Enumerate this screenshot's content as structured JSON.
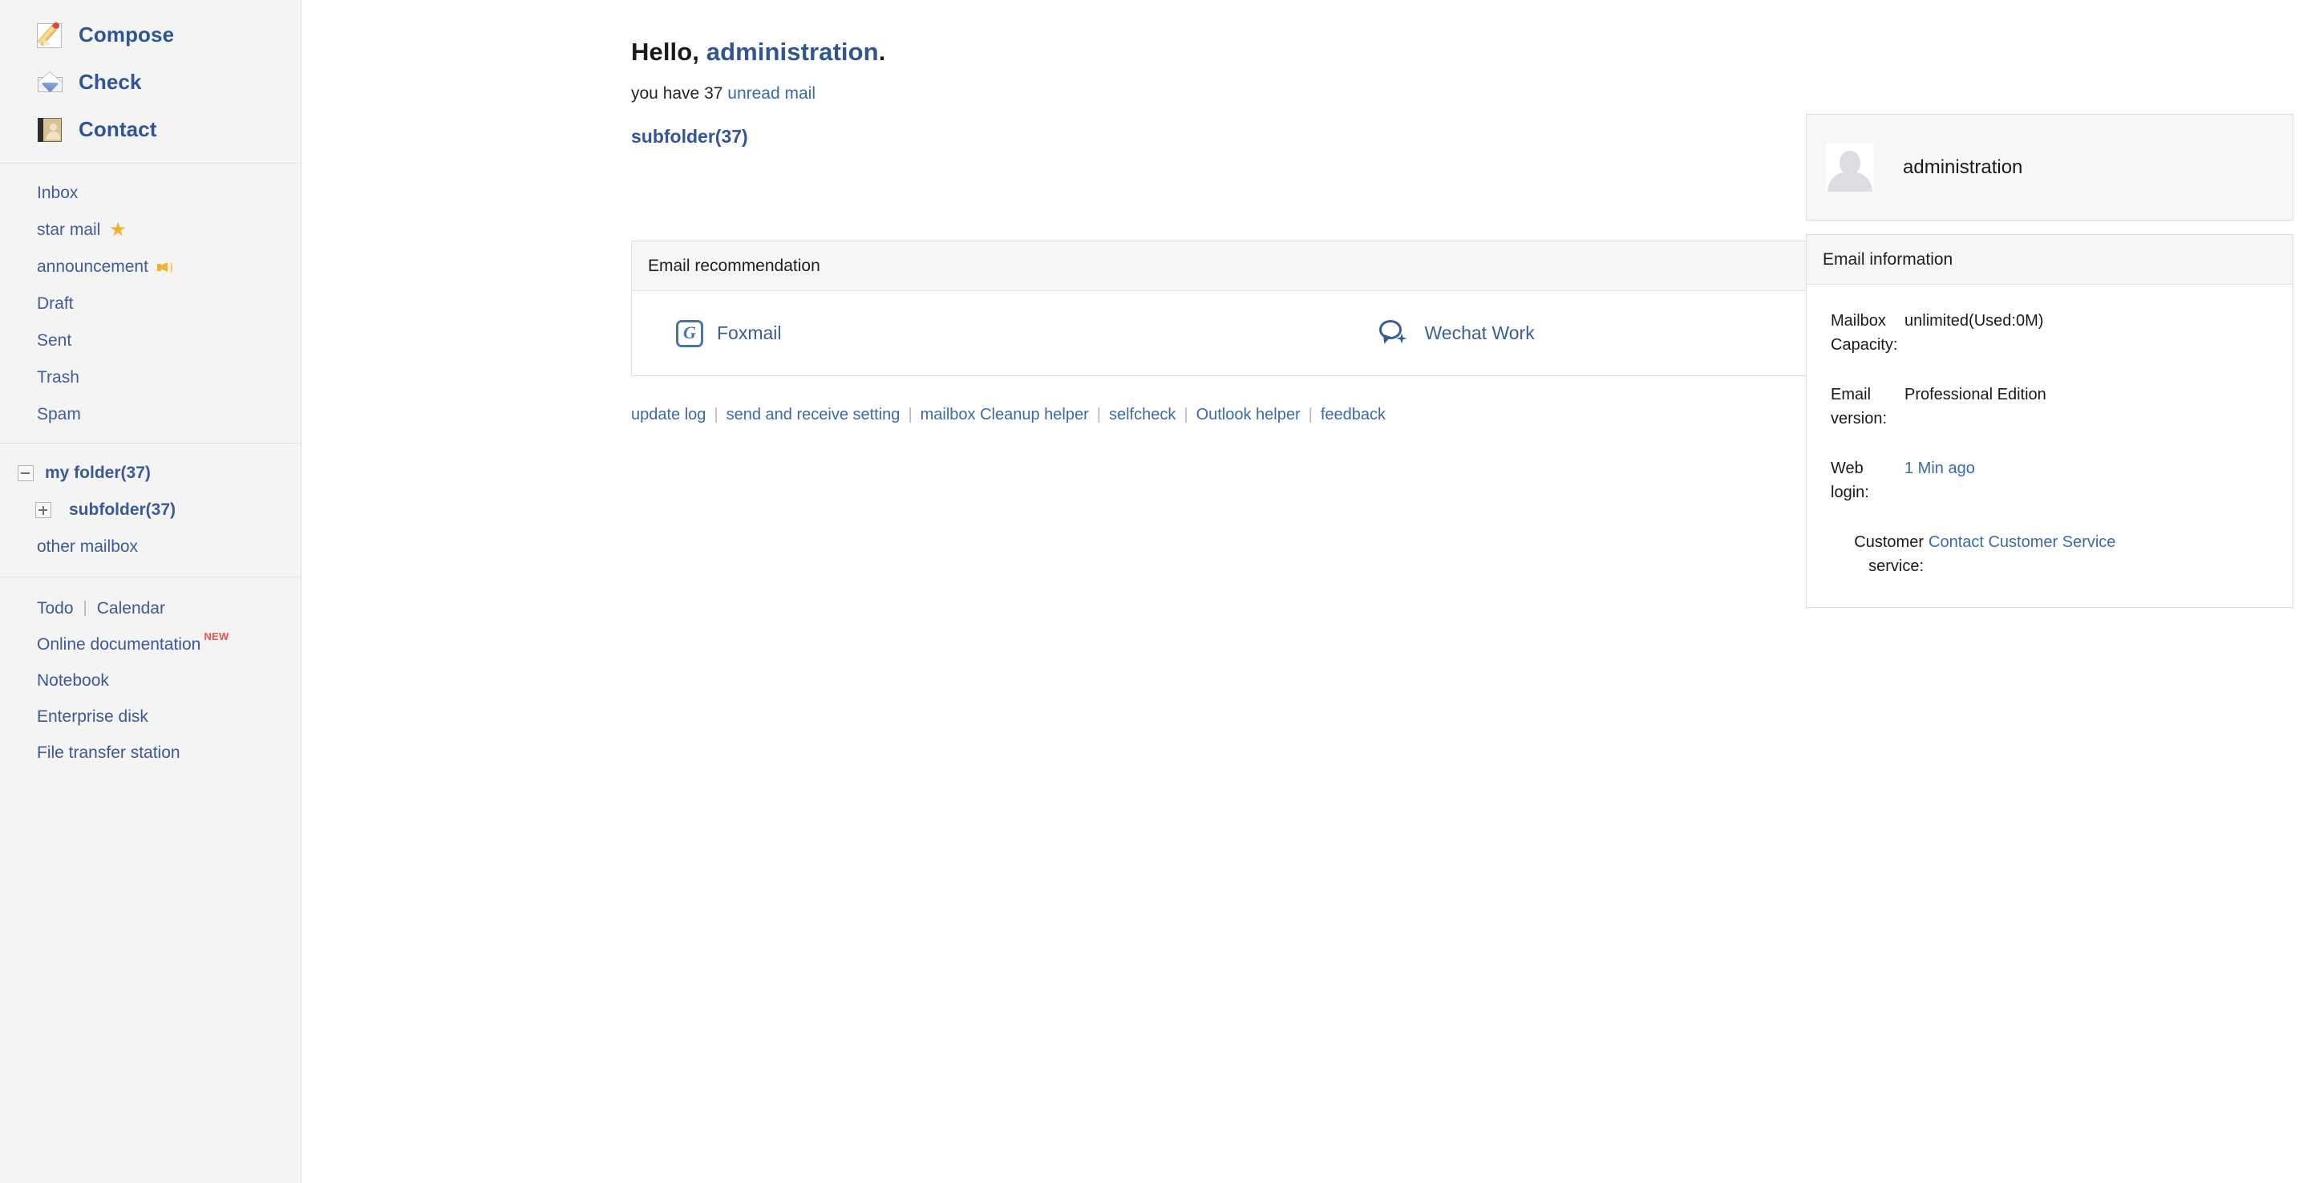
{
  "sidebar": {
    "primary": [
      {
        "label": "Compose",
        "icon": "compose-icon"
      },
      {
        "label": "Check",
        "icon": "check-mail-icon"
      },
      {
        "label": "Contact",
        "icon": "contact-book-icon"
      }
    ],
    "folders": [
      {
        "label": "Inbox",
        "icon": ""
      },
      {
        "label": "star mail",
        "icon": "star-icon"
      },
      {
        "label": "announcement",
        "icon": "megaphone-icon"
      },
      {
        "label": "Draft",
        "icon": ""
      },
      {
        "label": "Sent",
        "icon": ""
      },
      {
        "label": "Trash",
        "icon": ""
      },
      {
        "label": "Spam",
        "icon": ""
      }
    ],
    "my_folder": {
      "label": "my folder(37)",
      "toggle": "minus",
      "children": [
        {
          "label": "subfolder(37)",
          "toggle": "plus"
        }
      ]
    },
    "other_mailbox": "other mailbox",
    "tools": {
      "todo": "Todo",
      "todo_separator": "|",
      "calendar": "Calendar",
      "online_documentation": "Online documentation",
      "new_badge": "NEW",
      "notebook": "Notebook",
      "enterprise_disk": "Enterprise disk",
      "file_transfer_station": "File transfer station"
    }
  },
  "main": {
    "greeting_prefix": "Hello,",
    "greeting_user": "administration",
    "greeting_suffix": ".",
    "unread_prefix": "you have 37",
    "unread_link": "unread mail",
    "folder_link": "subfolder(37)",
    "recommendation": {
      "title": "Email recommendation",
      "items": [
        {
          "label": "Foxmail",
          "icon": "foxmail-icon"
        },
        {
          "label": "Wechat Work",
          "icon": "wechat-work-icon"
        }
      ]
    },
    "links": [
      "update log",
      "send and receive setting",
      "mailbox Cleanup helper",
      "selfcheck",
      "Outlook helper",
      "feedback"
    ],
    "link_separator": "|"
  },
  "right": {
    "profile_name": "administration",
    "info_title": "Email information",
    "info_rows": [
      {
        "label": "Mailbox Capacity:",
        "value": "unlimited(Used:0M)",
        "is_link": false
      },
      {
        "label": "Email version:",
        "value": "Professional Edition",
        "is_link": false
      },
      {
        "label": "Web login:",
        "value": "1 Min ago",
        "is_link": true
      },
      {
        "label": "Customer service:",
        "value": "Contact Customer Service",
        "is_link": true
      }
    ]
  },
  "colors": {
    "link_blue": "#3b6aa8",
    "brand_blue": "#2f5596",
    "star_yellow": "#f0b429",
    "badge_red": "#e8554d",
    "panel_bg": "#f6f6f6",
    "sidebar_bg": "#f4f4f4",
    "border": "#dddddd"
  }
}
